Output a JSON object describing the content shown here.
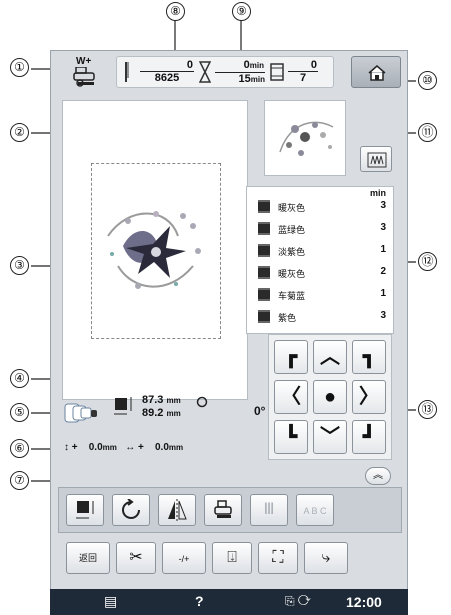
{
  "callouts": [
    "①",
    "②",
    "③",
    "④",
    "⑤",
    "⑥",
    "⑦",
    "⑧",
    "⑨",
    "⑩",
    "⑪",
    "⑫",
    "⑬"
  ],
  "stitch_counter": {
    "done": "0",
    "total": "8625"
  },
  "time_counter": {
    "done": "0",
    "total": "15",
    "unit": "min"
  },
  "color_counter": {
    "done": "0",
    "total": "7"
  },
  "presser_foot_label": "W+",
  "size": {
    "width": "87.3",
    "height": "89.2",
    "unit": "mm"
  },
  "offset": {
    "vertical_sign": "+",
    "vertical": "0.0",
    "horizontal_sign": "+",
    "horizontal": "0.0",
    "unit": "mm"
  },
  "angle": "0°",
  "thread_list_header": "min",
  "threads": [
    {
      "name": "暖灰色",
      "minutes": "3"
    },
    {
      "name": "蓝绿色",
      "minutes": "3"
    },
    {
      "name": "淡紫色",
      "minutes": "1"
    },
    {
      "name": "暖灰色",
      "minutes": "2"
    },
    {
      "name": "车菊蓝",
      "minutes": "1"
    },
    {
      "name": "紫色",
      "minutes": "3"
    }
  ],
  "buttons": {
    "back_label": "返回",
    "help_label": "?",
    "clock": "12:00",
    "needle_label": "-/+"
  },
  "colors": {
    "screen_bg": "#d9dde2",
    "status_bar": "#1e2a38"
  }
}
